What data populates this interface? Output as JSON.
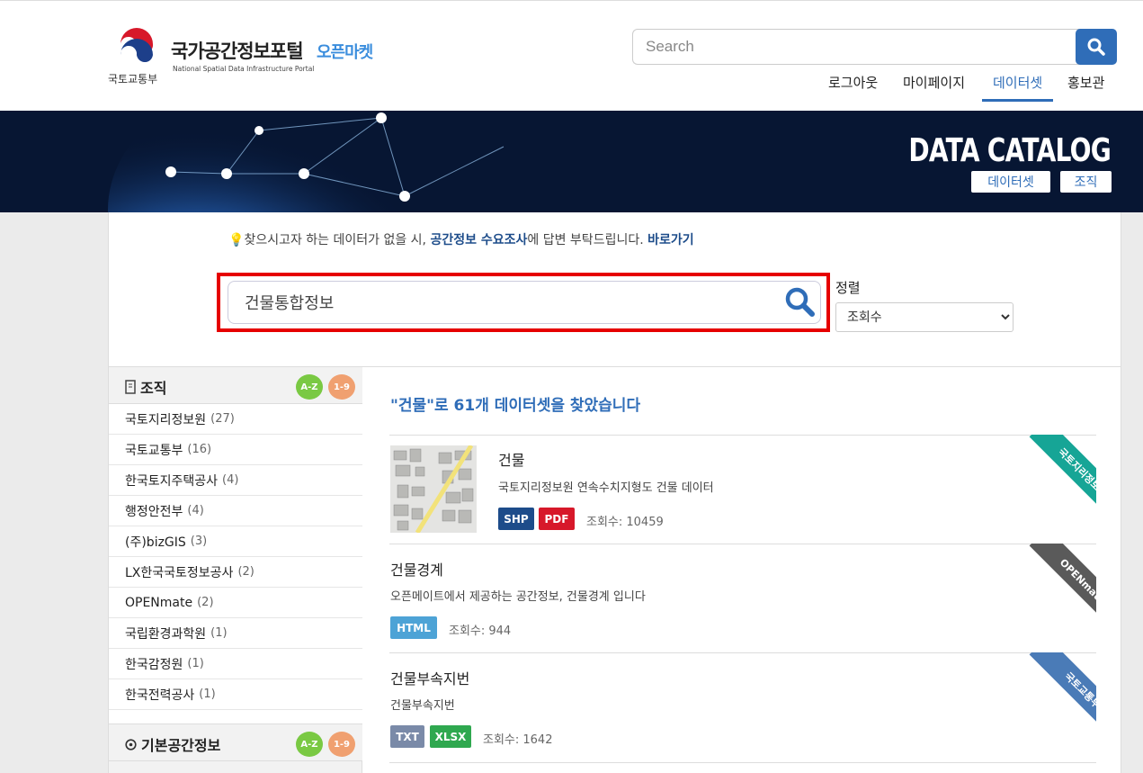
{
  "header": {
    "ministry": "국토교통부",
    "portal_title": "국가공간정보포털",
    "portal_sub": "오픈마켓",
    "portal_eng": "National Spatial Data Infrastructure Portal",
    "search_placeholder": "Search",
    "nav": [
      "로그아웃",
      "마이페이지",
      "데이터셋",
      "홍보관"
    ],
    "active_nav": "데이터셋"
  },
  "banner": {
    "title": "DATA CATALOG",
    "buttons": [
      "데이터셋",
      "조직"
    ]
  },
  "notice": {
    "before": "찾으시고자 하는 데이터가 없을 시, ",
    "link1": "공간정보 수요조사",
    "middle": "에 답변 부탁드립니다. ",
    "link2": "바로가기"
  },
  "search": {
    "value": "건물통합정보"
  },
  "sort": {
    "label": "정렬",
    "selected": "조회수"
  },
  "sidebar": {
    "org_title": "조직",
    "az": "A-Z",
    "num": "1-9",
    "orgs": [
      {
        "name": "국토지리정보원",
        "count": "(27)"
      },
      {
        "name": "국토교통부",
        "count": "(16)"
      },
      {
        "name": "한국토지주택공사",
        "count": "(4)"
      },
      {
        "name": "행정안전부",
        "count": "(4)"
      },
      {
        "name": "(주)bizGIS",
        "count": "(3)"
      },
      {
        "name": "LX한국국토정보공사",
        "count": "(2)"
      },
      {
        "name": "OPENmate",
        "count": "(2)"
      },
      {
        "name": "국립환경과학원",
        "count": "(1)"
      },
      {
        "name": "한국감정원",
        "count": "(1)"
      },
      {
        "name": "한국전력공사",
        "count": "(1)"
      }
    ],
    "basic_title": "기본공간정보"
  },
  "results": {
    "summary": "\"건물\"로 61개 데이터셋을 찾았습니다",
    "items": [
      {
        "name": "건물",
        "desc": "국토지리정보원 연속수치지형도 건물 데이터",
        "tags": [
          "SHP",
          "PDF"
        ],
        "views": "조회수: 10459",
        "ribbon": "국토지리정보원",
        "ribbon_color": "#16a596"
      },
      {
        "name": "건물경계",
        "desc": "오픈메이트에서 제공하는 공간정보, 건물경계 입니다",
        "tags": [
          "HTML"
        ],
        "views": "조회수: 944",
        "ribbon": "OPENmate",
        "ribbon_color": "#5a5a5a"
      },
      {
        "name": "건물부속지번",
        "desc": "건물부속지번",
        "tags": [
          "TXT",
          "XLSX"
        ],
        "views": "조회수: 1642",
        "ribbon": "국토교통부",
        "ribbon_color": "#4a7bb7"
      }
    ]
  },
  "colors": {
    "accent": "#2f6db8",
    "highlight_border": "#e60000",
    "shp": "#1d4c8a",
    "pdf": "#d7182a",
    "html": "#4da3d6",
    "txt": "#7a8aa8",
    "xlsx": "#2fa84f"
  }
}
